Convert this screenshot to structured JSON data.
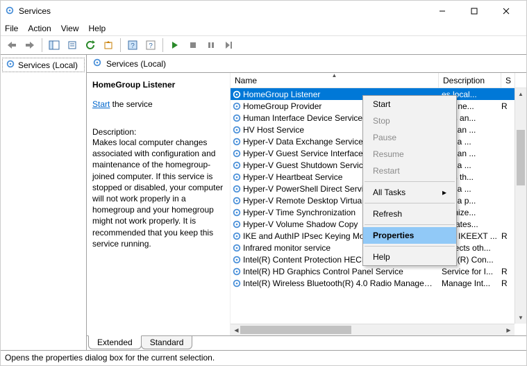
{
  "window": {
    "title": "Services"
  },
  "menubar": [
    "File",
    "Action",
    "View",
    "Help"
  ],
  "nav": {
    "item_label": "Services (Local)"
  },
  "content_header": "Services (Local)",
  "detail": {
    "heading": "HomeGroup Listener",
    "start_link": "Start",
    "start_suffix": " the service",
    "desc_label": "Description:",
    "desc": "Makes local computer changes associated with configuration and maintenance of the homegroup-joined computer. If this service is stopped or disabled, your computer will not work properly in a homegroup and your homegroup might not work properly. It is recommended that you keep this service running."
  },
  "columns": {
    "name": "Name",
    "desc": "Description",
    "s": "S"
  },
  "services": [
    {
      "name": "HomeGroup Listener",
      "desc": "es local...",
      "s": "",
      "selected": true
    },
    {
      "name": "HomeGroup Provider",
      "desc": "rms ne...",
      "s": "R"
    },
    {
      "name": "Human Interface Device Service",
      "desc": "ates an...",
      "s": ""
    },
    {
      "name": "HV Host Service",
      "desc": "des an ...",
      "s": ""
    },
    {
      "name": "Hyper-V Data Exchange Service",
      "desc": "des a ...",
      "s": ""
    },
    {
      "name": "Hyper-V Guest Service Interface",
      "desc": "des an ...",
      "s": ""
    },
    {
      "name": "Hyper-V Guest Shutdown Service",
      "desc": "des a ...",
      "s": ""
    },
    {
      "name": "Hyper-V Heartbeat Service",
      "desc": "itors th...",
      "s": ""
    },
    {
      "name": "Hyper-V PowerShell Direct Service",
      "desc": "des a ...",
      "s": ""
    },
    {
      "name": "Hyper-V Remote Desktop Virtualization",
      "desc": "des a p...",
      "s": ""
    },
    {
      "name": "Hyper-V Time Synchronization",
      "desc": "hronize...",
      "s": ""
    },
    {
      "name": "Hyper-V Volume Shadow Copy",
      "desc": "rdinates...",
      "s": ""
    },
    {
      "name": "IKE and AuthIP IPsec Keying Modules",
      "desc": "The IKEEXT ...",
      "s": "R"
    },
    {
      "name": "Infrared monitor service",
      "desc": "Detects oth...",
      "s": ""
    },
    {
      "name": "Intel(R) Content Protection HECI Service",
      "desc": "Intel(R) Con...",
      "s": ""
    },
    {
      "name": "Intel(R) HD Graphics Control Panel Service",
      "desc": "Service for I...",
      "s": "R"
    },
    {
      "name": "Intel(R) Wireless Bluetooth(R) 4.0 Radio Management",
      "desc": "Manage Int...",
      "s": "R"
    }
  ],
  "context_menu": {
    "start": "Start",
    "stop": "Stop",
    "pause": "Pause",
    "resume": "Resume",
    "restart": "Restart",
    "all_tasks": "All Tasks",
    "refresh": "Refresh",
    "properties": "Properties",
    "help": "Help"
  },
  "tabs": {
    "extended": "Extended",
    "standard": "Standard"
  },
  "statusbar": "Opens the properties dialog box for the current selection."
}
